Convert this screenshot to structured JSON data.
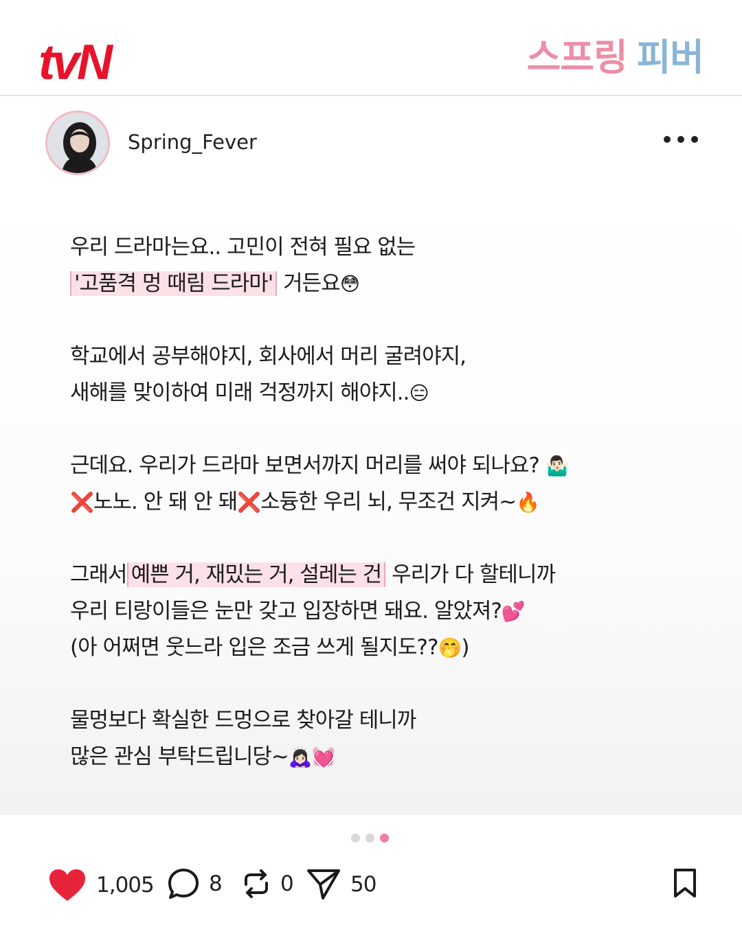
{
  "header": {
    "brand_logo": "tvN",
    "show_title_part1": "스프링",
    "show_title_part2": "피버",
    "brand_color": "#e8132b"
  },
  "profile": {
    "username": "Spring_Fever",
    "avatar_icon": "avatar-photo",
    "more_icon": "more-horizontal-icon"
  },
  "post": {
    "lines": [
      {
        "text": "우리 드라마는요.. 고민이 전혀 필요 없는"
      },
      {
        "highlight": "'고품격 멍 때림 드라마'",
        "text": "거든요",
        "emoji": "😳"
      },
      {
        "text": "학교에서 공부해야지, 회사에서 머리 굴려야지,"
      },
      {
        "text": "새해를 맞이하여 미래 걱정까지 해야지..",
        "emoji": "😑"
      },
      {
        "text": "근데요. 우리가 드라마 보면서까지 머리를 써야 되나요?",
        "emoji": "🤷🏻‍♂️"
      },
      {
        "emoji_start": "❌",
        "text": "노노. 안 돼 안 돼",
        "emoji_mid": "❌",
        "text2": "소듕한 우리 뇌, 무조건 지켜~",
        "emoji": "🔥"
      },
      {
        "text": "그래서",
        "highlight": "예쁜 거, 재밌는 거, 설레는 건",
        "text2": "우리가 다 할테니까"
      },
      {
        "text": "우리 티랑이들은 눈만 갖고 입장하면 돼요. 알았져?",
        "emoji": "💕"
      },
      {
        "text": "(아 어쩌면 웃느라 입은 조금 쓰게 될지도??",
        "emoji": "🤭",
        "text2": ")"
      },
      {
        "text": "물멍보다 확실한 드멍으로 찾아갈 테니까"
      },
      {
        "text": "많은 관심 부탁드립니당~",
        "emoji": "🙇🏻‍♀️💓"
      }
    ]
  },
  "pager": {
    "total": 3,
    "active_index": 2,
    "active_color": "#ef7fa0"
  },
  "actions": {
    "likes": "1,005",
    "comments": "8",
    "reposts": "0",
    "shares": "50",
    "like_color": "#e8243a"
  }
}
